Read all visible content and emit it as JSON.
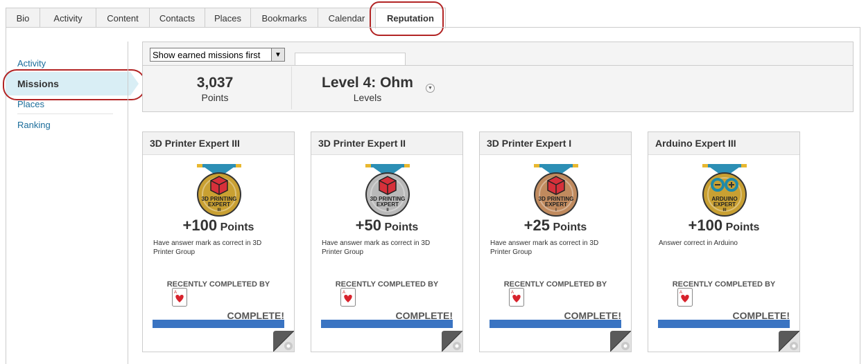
{
  "tabs": [
    {
      "label": "Bio"
    },
    {
      "label": "Activity"
    },
    {
      "label": "Content"
    },
    {
      "label": "Contacts"
    },
    {
      "label": "Places"
    },
    {
      "label": "Bookmarks"
    },
    {
      "label": "Calendar"
    },
    {
      "label": "Reputation",
      "active": true
    }
  ],
  "sidebar": {
    "items": [
      {
        "label": "Activity"
      },
      {
        "label": "Missions",
        "active": true
      },
      {
        "label": "Places"
      },
      {
        "label": "Ranking"
      }
    ]
  },
  "filter": {
    "selected": "Show earned missions first"
  },
  "stats": {
    "points_value": "3,037",
    "points_label": "Points",
    "level_value": "Level 4: Ohm",
    "level_label": "Levels"
  },
  "colors": {
    "highlight_ring": "#b22424",
    "active_side": "#d9eef5",
    "progress": "#3a74c2",
    "link": "#1a6c9a"
  },
  "missions": [
    {
      "title": "3D Printer Expert III",
      "badge_icon": "3d-printing-expert-badge",
      "badge_text": [
        "3D PRINTING",
        "EXPERT",
        "III"
      ],
      "badge_color": "#c9a032",
      "points": "+100",
      "points_label": "Points",
      "description": "Have answer mark as correct in 3D Printer Group",
      "recent_label": "RECENTLY COMPLETED BY",
      "status": "COMPLETE!",
      "progress": 1.0
    },
    {
      "title": "3D Printer Expert II",
      "badge_icon": "3d-printing-expert-badge",
      "badge_text": [
        "3D PRINTING",
        "EXPERT",
        "II"
      ],
      "badge_color": "#b9b9b9",
      "points": "+50",
      "points_label": "Points",
      "description": "Have answer mark as correct in 3D Printer Group",
      "recent_label": "RECENTLY COMPLETED BY",
      "status": "COMPLETE!",
      "progress": 1.0
    },
    {
      "title": "3D Printer Expert I",
      "badge_icon": "3d-printing-expert-badge",
      "badge_text": [
        "3D PRINTING",
        "EXPERT",
        "I"
      ],
      "badge_color": "#c08a5e",
      "points": "+25",
      "points_label": "Points",
      "description": "Have answer mark as correct in 3D Printer Group",
      "recent_label": "RECENTLY COMPLETED BY",
      "status": "COMPLETE!",
      "progress": 1.0
    },
    {
      "title": "Arduino Expert III",
      "badge_icon": "arduino-expert-badge",
      "badge_text": [
        "ARDUINO",
        "EXPERT",
        "III"
      ],
      "badge_color": "#c9a032",
      "points": "+100",
      "points_label": "Points",
      "description": "Answer correct in Arduino",
      "recent_label": "RECENTLY COMPLETED BY",
      "status": "COMPLETE!",
      "progress": 1.0
    }
  ]
}
